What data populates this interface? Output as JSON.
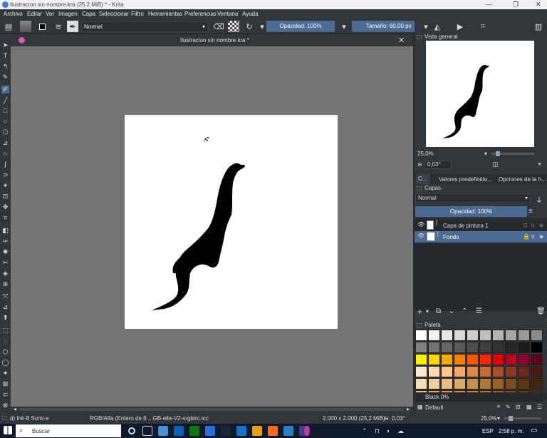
{
  "window": {
    "title": "Ilustracion sin nombre.kra  (25,2 MiB)  * - Krita"
  },
  "menu": [
    "Archivo",
    "Editar",
    "Ver",
    "Imagen",
    "Capa",
    "Seleccionar",
    "Filtro",
    "Herramientas",
    "Preferencias",
    "Ventana",
    "Ayuda"
  ],
  "toolbar": {
    "blend_mode": "Normal",
    "opacity": "Opacidad: 100%",
    "size_label": "Tamaño:",
    "size_value": "60,00 px"
  },
  "document": {
    "tab_title": "Ilustracion sin nombre.kra *"
  },
  "overview": {
    "title": "Vista general",
    "zoom": "25,0%",
    "rotation": "0,03°",
    "tabs": [
      "C...",
      "Valores predefinido...",
      "Opciones de la h..."
    ]
  },
  "layers": {
    "title": "Capas",
    "blend_mode": "Normal",
    "opacity": "Opacidad:  100%",
    "items": [
      {
        "name": "Capa de pintura 1"
      },
      {
        "name": "Fondo"
      }
    ]
  },
  "palette": {
    "title": "Paleta",
    "selected_color": "Black 0%",
    "palette_name": "Default"
  },
  "colors": {
    "swatches": [
      "#ffffff",
      "#f2f2f2",
      "#e6e6e6",
      "#d9d9d9",
      "#cccccc",
      "#bfbfbf",
      "#b3b3b3",
      "#a6a6a6",
      "#999999",
      "#8c8c8c",
      "#808080",
      "#737373",
      "#666666",
      "#595959",
      "#4d4d4d",
      "#404040",
      "#333333",
      "#262626",
      "#1a1a1a",
      "#000000",
      "#fff200",
      "#ffd400",
      "#ffaa00",
      "#ff7f00",
      "#ff5500",
      "#ff2a00",
      "#e40000",
      "#c00020",
      "#900030",
      "#600020",
      "#ffe8cc",
      "#ffd9b3",
      "#ffc68c",
      "#f5a86b",
      "#e0874c",
      "#c8693a",
      "#a84d2a",
      "#8a3a22",
      "#6a2a1a",
      "#4a1a12",
      "#f5deb3",
      "#eecfa0",
      "#e6be86",
      "#d9a86b",
      "#c89050",
      "#b07838",
      "#986228",
      "#7a4c1e",
      "#5e3816",
      "#42260e",
      "#f5c060",
      "#f0b040",
      "#eca030",
      "#e89020",
      "#e48010",
      "#c87010",
      "#a86010",
      "#885010",
      "#6a4010",
      "#4a3010"
    ]
  },
  "status": {
    "brush": "d) Ink-8 Sumi-e",
    "colorspace": "RGB/Alfa (Entero de 8 ...GB-elle-V2-srgbtrc.icc",
    "dimensions": "2.000 x 2.000 (25,2 MiB)",
    "rotation": "0,03°",
    "zoom": "25,0%"
  },
  "taskbar": {
    "search": "Buscar",
    "lang": "ESP",
    "time": "2:58 p. m."
  }
}
